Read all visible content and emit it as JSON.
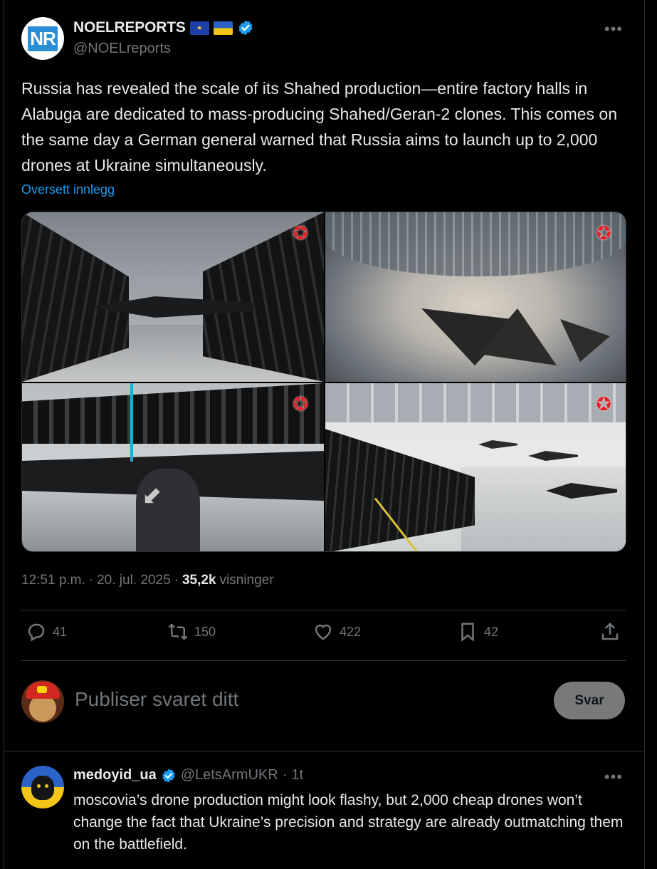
{
  "tweet": {
    "avatar_text": "NR",
    "display_name": "NOELREPORTS",
    "handle": "@NOELreports",
    "text": "Russia has revealed the scale of its Shahed production—entire factory halls in Alabuga are dedicated to mass-producing Shahed/Geran-2 clones. This comes on the same day a German general warned that Russia aims to launch up to 2,000 drones at Ukraine simultaneously.",
    "translate_label": "Oversett innlegg",
    "time": "12:51 p.m.",
    "date": "20. jul. 2025",
    "views_count": "35,2k",
    "views_label": "visninger",
    "separator": "·"
  },
  "actions": {
    "replies": "41",
    "reposts": "150",
    "likes": "422",
    "bookmarks": "42"
  },
  "composer": {
    "placeholder": "Publiser svaret ditt",
    "button_label": "Svar"
  },
  "reply": {
    "display_name": "medoyid_ua",
    "handle": "@LetsArmUKR",
    "separator": "·",
    "time": "1t",
    "text": "moscovia’s drone production might look flashy, but 2,000 cheap drones won’t change the fact that Ukraine’s precision and strategy are already outmatching them on the battlefield."
  },
  "colors": {
    "background": "#000000",
    "text": "#e7e9ea",
    "muted": "#71767b",
    "link": "#1d9bf0",
    "verified": "#1d9bf0",
    "divider": "#2f3336"
  }
}
